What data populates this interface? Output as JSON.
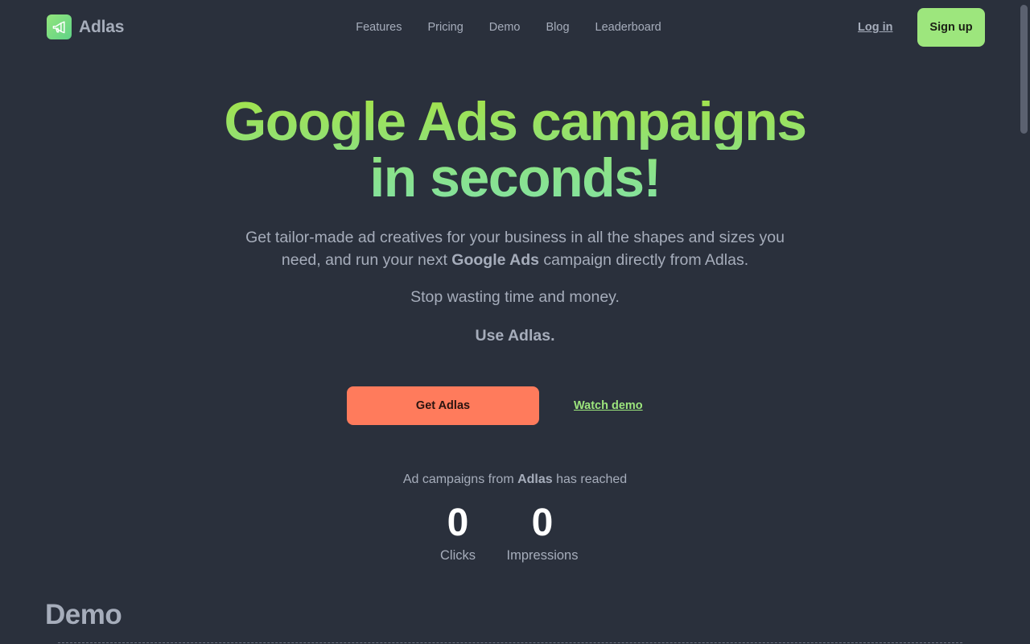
{
  "brand": {
    "name": "Adlas",
    "logo_icon": "megaphone-icon"
  },
  "nav": {
    "links": [
      "Features",
      "Pricing",
      "Demo",
      "Blog",
      "Leaderboard"
    ],
    "login_label": "Log in",
    "signup_label": "Sign up"
  },
  "hero": {
    "title_line1": "Google Ads campaigns",
    "title_line2": "in seconds!",
    "subtitle_part1": "Get tailor-made ad creatives for your business in all the shapes and sizes you need, and run your next ",
    "subtitle_bold": "Google Ads",
    "subtitle_part2": " campaign directly from Adlas.",
    "stop_text": "Stop wasting time and money.",
    "use_text": "Use Adlas.",
    "cta_label": "Get Adlas",
    "watch_label": "Watch demo"
  },
  "stats": {
    "reach_prefix": "Ad campaigns from ",
    "reach_brand": "Adlas",
    "reach_suffix": " has reached",
    "clicks_value": "0",
    "clicks_label": "Clicks",
    "impressions_value": "0",
    "impressions_label": "Impressions"
  },
  "demo": {
    "heading": "Demo"
  },
  "colors": {
    "background": "#2a303c",
    "primary": "#9de67d",
    "accent": "#ff7b5c",
    "text": "#a6adbb"
  }
}
